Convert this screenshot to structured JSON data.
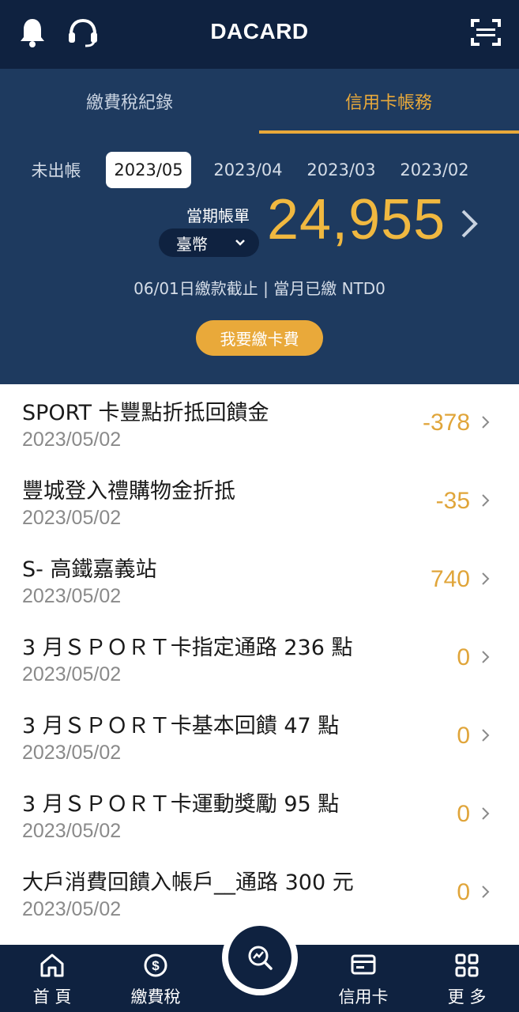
{
  "header": {
    "title": "DACARD"
  },
  "tabs": [
    {
      "label": "繳費稅紀錄"
    },
    {
      "label": "信用卡帳務"
    }
  ],
  "periods": [
    {
      "label": "未出帳"
    },
    {
      "label": "2023/05"
    },
    {
      "label": "2023/04"
    },
    {
      "label": "2023/03"
    },
    {
      "label": "2023/02"
    }
  ],
  "bill": {
    "label": "當期帳單",
    "currency": "臺幣",
    "amount": "24,955",
    "due_info": "06/01日繳款截止 | 當月已繳 NTD0",
    "pay_button": "我要繳卡費"
  },
  "transactions": [
    {
      "name": "SPORT 卡豐點折抵回饋金",
      "date": "2023/05/02",
      "amount": "-378"
    },
    {
      "name": "豐城登入禮購物金折抵",
      "date": "2023/05/02",
      "amount": "-35"
    },
    {
      "name": "S- 高鐵嘉義站",
      "date": "2023/05/02",
      "amount": "740"
    },
    {
      "name": "3 月ＳＰＯＲＴ卡指定通路 236 點",
      "date": "2023/05/02",
      "amount": "0"
    },
    {
      "name": "3 月ＳＰＯＲＴ卡基本回饋 47 點",
      "date": "2023/05/02",
      "amount": "0"
    },
    {
      "name": "3 月ＳＰＯＲＴ卡運動獎勵 95 點",
      "date": "2023/05/02",
      "amount": "0"
    },
    {
      "name": "大戶消費回饋入帳戶__通路 300 元",
      "date": "2023/05/02",
      "amount": "0"
    }
  ],
  "nav": [
    {
      "label": "首 頁"
    },
    {
      "label": "繳費稅"
    },
    {
      "label": "信用卡"
    },
    {
      "label": "更 多"
    }
  ],
  "colors": {
    "navy": "#0f2240",
    "panel": "#1e3a5f",
    "accent": "#e9a93a"
  }
}
